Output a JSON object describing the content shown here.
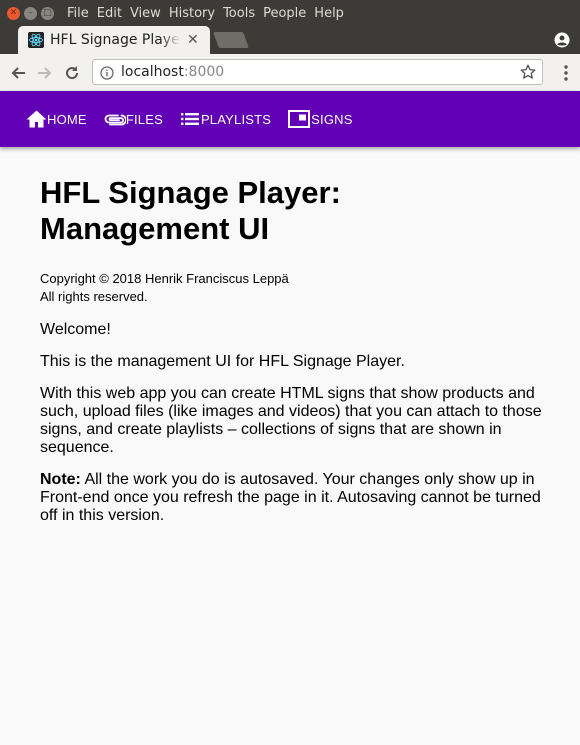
{
  "window": {
    "menu": [
      "File",
      "Edit",
      "View",
      "History",
      "Tools",
      "People",
      "Help"
    ]
  },
  "browser": {
    "tab_title": "HFL Signage Player: Management UI",
    "url_host": "localhost",
    "url_port": ":8000"
  },
  "nav": {
    "items": [
      {
        "label": "HOME",
        "icon": "home-icon"
      },
      {
        "label": "FILES",
        "icon": "paperclip-icon"
      },
      {
        "label": "PLAYLISTS",
        "icon": "list-icon"
      },
      {
        "label": "SIGNS",
        "icon": "sign-icon"
      }
    ],
    "background": "#6200b5"
  },
  "page": {
    "title_line1": "HFL Signage Player:",
    "title_line2": "Management UI",
    "copyright_line1": "Copyright © 2018 Henrik Franciscus Leppä",
    "copyright_line2": "All rights reserved.",
    "welcome": "Welcome!",
    "intro": "This is the management UI for HFL Signage Player.",
    "description": "With this web app you can create HTML signs that show products and such, upload files (like images and videos) that you can attach to those signs, and create playlists – collections of signs that are shown in sequence.",
    "note_label": "Note:",
    "note_text": " All the work you do is autosaved. Your changes only show up in Front-end once you refresh the page in it. Autosaving cannot be turned off in this version."
  }
}
